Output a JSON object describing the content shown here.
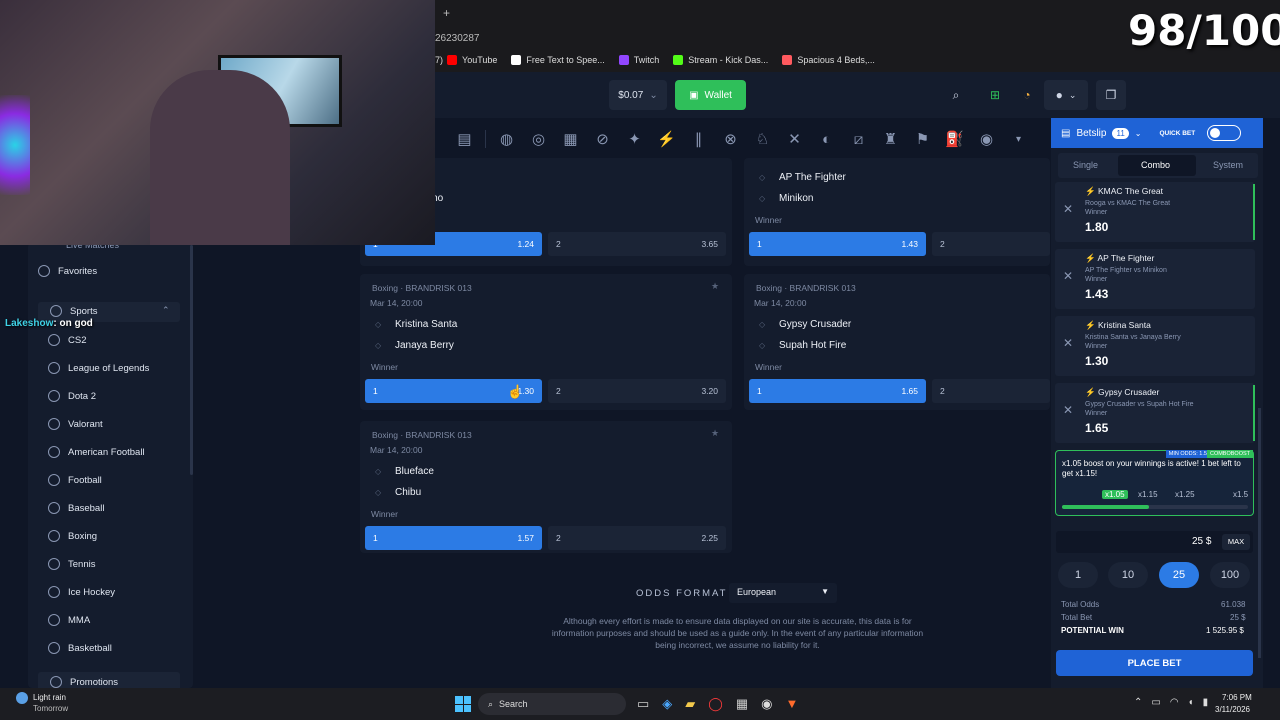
{
  "overlay": {
    "score": "98/100",
    "chat_user": "Lakeshow",
    "chat_msg": ": on god"
  },
  "browser": {
    "url_fragment": "26230287",
    "tab_plus": "+"
  },
  "bookmarks": [
    {
      "label": "YouTube",
      "prefix": "7)",
      "color": "#ff0000"
    },
    {
      "label": "Free Text to Spee...",
      "color": "#ffffff"
    },
    {
      "label": "Twitch",
      "color": "#9146ff"
    },
    {
      "label": "Stream - Kick Das...",
      "color": "#53fc18"
    },
    {
      "label": "Spacious 4 Beds,...",
      "color": "#ff5a5f"
    }
  ],
  "header": {
    "balance": "$0.07",
    "wallet_label": "Wallet"
  },
  "sidebar": {
    "live_label": "Live Matches",
    "favorites": "Favorites",
    "sports": "Sports",
    "items": [
      "CS2",
      "League of Legends",
      "Dota 2",
      "Valorant",
      "American Football",
      "Football",
      "Baseball",
      "Boxing",
      "Tennis",
      "Ice Hockey",
      "MMA",
      "Basketball"
    ],
    "promotions": "Promotions"
  },
  "cards": [
    {
      "team_a": "a",
      "team_b": "entino",
      "odd1": "1.24",
      "odd2": "3.65"
    },
    {
      "team_a": "AP The Fighter",
      "team_b": "Minikon",
      "market": "Winner",
      "odd1": "1.43",
      "odd2": ""
    },
    {
      "tag": "Boxing · BRANDRISK 013",
      "date": "Mar 14, 20:00",
      "team_a": "Kristina Santa",
      "team_b": "Janaya Berry",
      "market": "Winner",
      "odd1": "1.30",
      "odd2": "3.20"
    },
    {
      "tag": "Boxing · BRANDRISK 013",
      "date": "Mar 14, 20:00",
      "team_a": "Gypsy Crusader",
      "team_b": "Supah Hot Fire",
      "market": "Winner",
      "odd1": "1.65",
      "odd2": ""
    },
    {
      "tag": "Boxing · BRANDRISK 013",
      "date": "Mar 14, 20:00",
      "team_a": "Blueface",
      "team_b": "Chibu",
      "market": "Winner",
      "odd1": "1.57",
      "odd2": "2.25"
    }
  ],
  "odds_labels": {
    "one": "1",
    "two": "2"
  },
  "odds_format": {
    "label": "ODDS FORMAT",
    "value": "European"
  },
  "disclaimer": "Although every effort is made to ensure data displayed on our site is accurate, this data is for information purposes and should be used as a guide only. In the event of any particular information being incorrect, we assume no liability for it.",
  "betslip": {
    "title": "Betslip",
    "count": "11",
    "quick_bet": "QUICK BET",
    "tabs": [
      "Single",
      "Combo",
      "System"
    ],
    "bets": [
      {
        "team": "KMAC The Great",
        "match": "Rooga vs KMAC The Great",
        "market": "Winner",
        "odd": "1.80"
      },
      {
        "team": "AP The Fighter",
        "match": "AP The Fighter vs Minikon",
        "market": "Winner",
        "odd": "1.43"
      },
      {
        "team": "Kristina Santa",
        "match": "Kristina Santa vs Janaya Berry",
        "market": "Winner",
        "odd": "1.30"
      },
      {
        "team": "Gypsy Crusader",
        "match": "Gypsy Crusader vs Supah Hot Fire",
        "market": "Winner",
        "odd": "1.65"
      }
    ],
    "boost_badge1": "MIN ODDS: 1.50",
    "boost_badge2": "COMBOBOOST",
    "boost_text": "x1.05 boost on your winnings is active! 1 bet left to get x1.15!",
    "boost_levels": [
      "x1.05",
      "x1.15",
      "x1.25",
      "x1.5"
    ],
    "stake_value": "25 $",
    "max": "MAX",
    "stakes": [
      "1",
      "10",
      "25",
      "100"
    ],
    "total_odds_label": "Total Odds",
    "total_odds": "61.038",
    "total_bet_label": "Total Bet",
    "total_bet": "25 $",
    "potential_label": "POTENTIAL WIN",
    "potential": "1 525.95 $",
    "place_bet": "PLACE BET"
  },
  "taskbar": {
    "weather": "Light rain",
    "weather_sub": "Tomorrow",
    "search": "Search",
    "time": "7:06 PM",
    "date": "3/11/2026"
  }
}
